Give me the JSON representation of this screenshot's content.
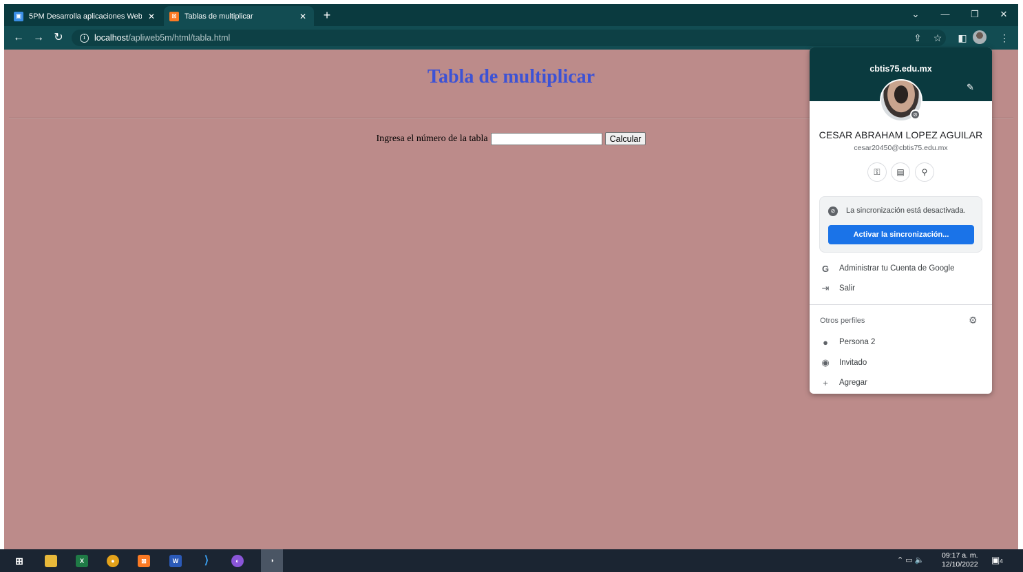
{
  "tabs": [
    {
      "title": "5PM Desarrolla aplicaciones Web",
      "favicon": "classroom-icon",
      "active": false
    },
    {
      "title": "Tablas de multiplicar",
      "favicon": "xampp-icon",
      "active": true
    }
  ],
  "toolbar": {
    "url_host": "localhost",
    "url_path": "/apliweb5m/html/tabla.html"
  },
  "page": {
    "title": "Tabla de multiplicar",
    "input_label": "Ingresa el número de la tabla",
    "input_value": "",
    "button_label": "Calcular",
    "background_color": "#bc8b8a",
    "title_color": "#3d52d5"
  },
  "profile": {
    "domain": "cbtis75.edu.mx",
    "name": "CESAR ABRAHAM LOPEZ AGUILAR",
    "email": "cesar20450@cbtis75.edu.mx",
    "sync_status": "La sincronización está desactivada.",
    "sync_button": "Activar la sincronización...",
    "manage_account": "Administrar tu Cuenta de Google",
    "sign_out": "Salir",
    "other_profiles_label": "Otros perfiles",
    "other_profiles": [
      {
        "name": "Persona 2",
        "icon": "person-icon"
      },
      {
        "name": "Invitado",
        "icon": "guest-icon"
      }
    ],
    "add_label": "Agregar",
    "accent_color": "#1a73e8"
  },
  "taskbar": {
    "time": "09:17 a. m.",
    "date": "12/10/2022",
    "notification_count": "4",
    "apps": [
      "windows-start-icon",
      "file-explorer-icon",
      "excel-icon",
      "chrome-icon",
      "xampp-icon",
      "word-icon",
      "vscode-icon",
      "github-desktop-icon",
      "chrome-profile-icon"
    ]
  }
}
